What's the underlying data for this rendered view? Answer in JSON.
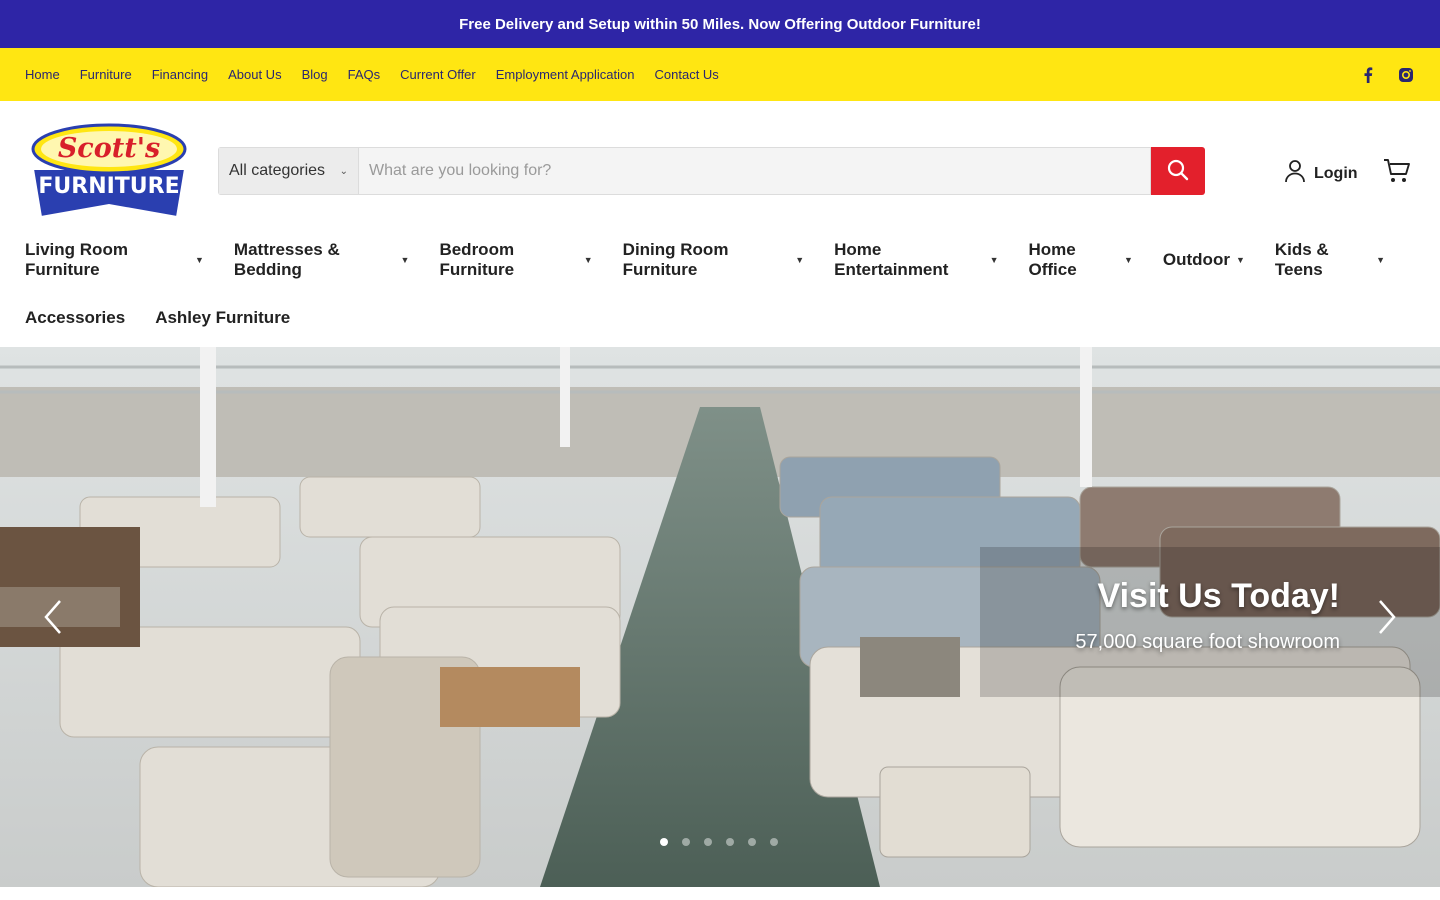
{
  "announcement": {
    "text": "Free Delivery and Setup within 50 Miles. Now Offering Outdoor Furniture!"
  },
  "utility_nav": [
    "Home",
    "Furniture",
    "Financing",
    "About Us",
    "Blog",
    "FAQs",
    "Current Offer",
    "Employment Application",
    "Contact Us"
  ],
  "social": {
    "icons": [
      "facebook-icon",
      "instagram-icon"
    ]
  },
  "logo": {
    "line1": "Scott's",
    "line2": "FURNITURE"
  },
  "search": {
    "category": "All categories",
    "placeholder": "What are you looking for?",
    "value": ""
  },
  "account": {
    "login_label": "Login"
  },
  "main_nav": {
    "row1": [
      "Living Room Furniture",
      "Mattresses & Bedding",
      "Bedroom Furniture",
      "Dining Room Furniture",
      "Home Entertainment",
      "Home Office",
      "Outdoor",
      "Kids & Teens"
    ],
    "row2": [
      "Accessories",
      "Ashley Furniture"
    ]
  },
  "hero": {
    "title": "Visit Us Today!",
    "subtitle": "57,000 square foot showroom",
    "slide_count": 6,
    "active_slide": 1
  },
  "colors": {
    "announcement_bg": "#2e25a6",
    "utility_bg": "#ffe612",
    "search_button": "#e3202c"
  }
}
